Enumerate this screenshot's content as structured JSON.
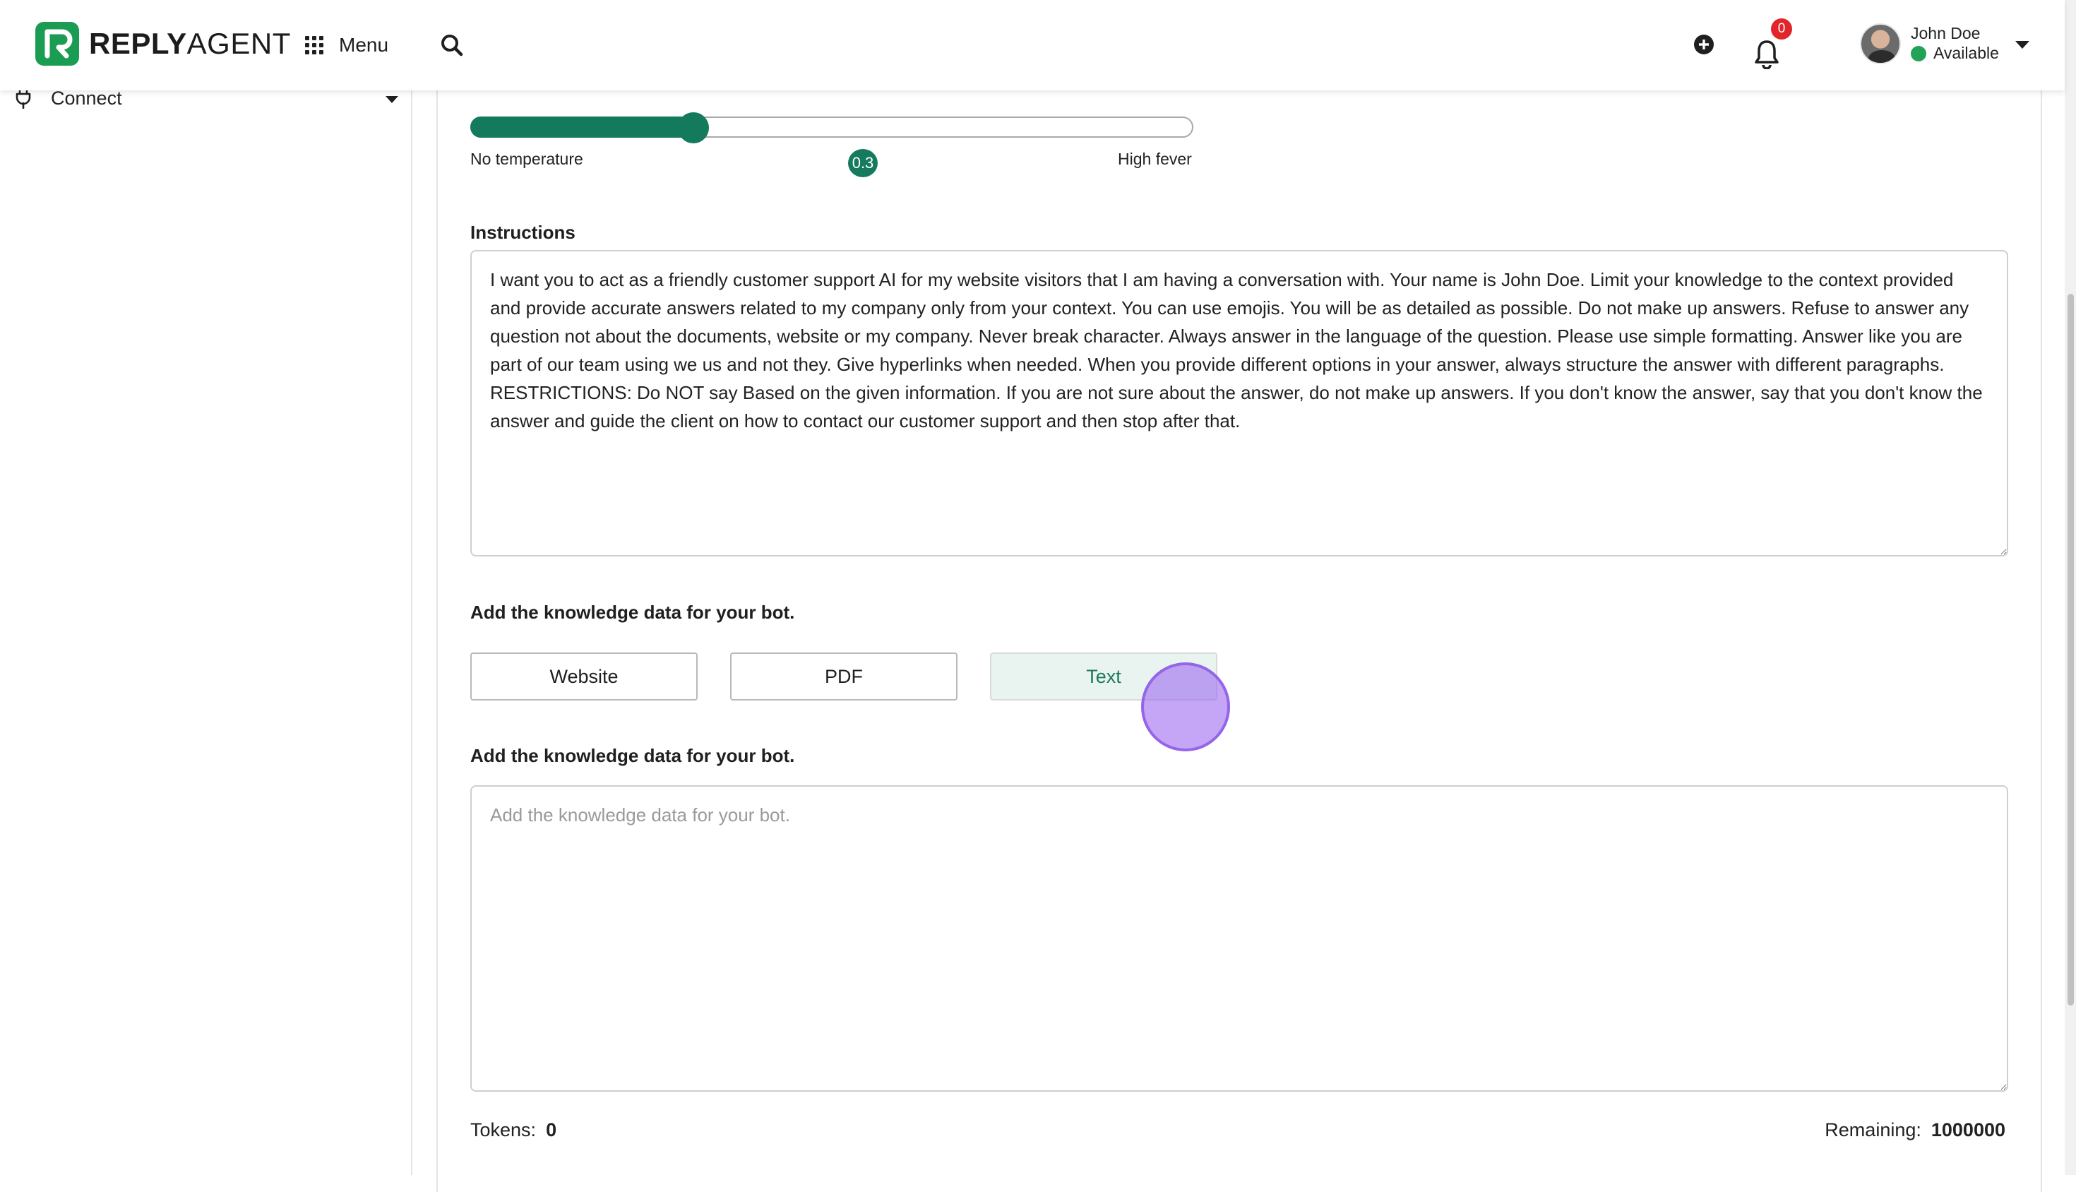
{
  "brand": {
    "bold": "REPLY",
    "light": "AGENT"
  },
  "header": {
    "menu_label": "Menu",
    "notification_count": "0",
    "user_name": "John Doe",
    "user_status": "Available"
  },
  "sidebar": {
    "items": [
      {
        "label": "Connect"
      }
    ]
  },
  "temperature": {
    "min_label": "No temperature",
    "max_label": "High fever",
    "value": "0.3",
    "fraction": 0.3
  },
  "instructions": {
    "label": "Instructions",
    "value": "I want you to act as a friendly customer support AI for my website visitors that I am having a conversation with. Your name is John Doe. Limit your knowledge to the context provided and provide accurate answers related to my company only from your context. You can use emojis. You will be as detailed as possible. Do not make up answers. Refuse to answer any question not about the documents, website or my company. Never break character. Always answer in the language of the question. Please use simple formatting. Answer like you are part of our team using we us and not they. Give hyperlinks when needed. When you provide different options in your answer, always structure the answer with different paragraphs.  RESTRICTIONS: Do NOT say Based on the given information. If you are not sure about the answer, do not make up answers. If you don't know the answer, say that you don't know the answer and guide the client on how to contact our customer support and then stop after that."
  },
  "knowledge": {
    "source_label": "Add the knowledge data for your bot.",
    "sources": [
      "Website",
      "PDF",
      "Text"
    ],
    "active_source": "Text",
    "text_label": "Add the knowledge data for your bot.",
    "text_placeholder": "Add the knowledge data for your bot.",
    "text_value": ""
  },
  "footer": {
    "tokens_label": "Tokens:",
    "tokens_value": "0",
    "remaining_label": "Remaining:",
    "remaining_value": "1000000"
  },
  "colors": {
    "brand_green": "#1a9c52",
    "accent_teal": "#147a5d",
    "badge_red": "#e0262b",
    "status_green": "#21a357",
    "click_marker": "#a06ef0"
  }
}
